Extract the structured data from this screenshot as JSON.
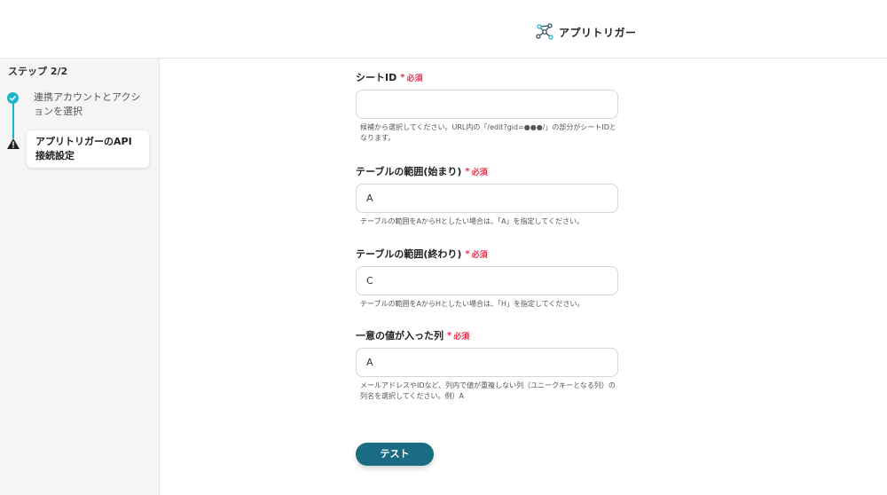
{
  "header": {
    "brand_name": "アプリトリガー",
    "logo_icon": "network-nodes-icon"
  },
  "sidebar": {
    "step_count": "ステップ 2/2",
    "steps": [
      {
        "label": "連携アカウントとアクションを選択",
        "status": "done",
        "icon": "check-circle-icon"
      },
      {
        "label": "アプリトリガーのAPI接続設定",
        "status": "current",
        "icon": "warning-icon"
      }
    ]
  },
  "form": {
    "required_mark": "*",
    "required_text": "必須",
    "fields": [
      {
        "label": "シートID",
        "value": "",
        "help": "候補から選択してください。URL内の「/edit?gid=●●●/」の部分がシートIDとなります。"
      },
      {
        "label": "テーブルの範囲(始まり)",
        "value": "A",
        "help": "テーブルの範囲をAからHとしたい場合は、「A」を指定してください。"
      },
      {
        "label": "テーブルの範囲(終わり)",
        "value": "C",
        "help": "テーブルの範囲をAからHとしたい場合は、「H」を指定してください。"
      },
      {
        "label": "一意の値が入った列",
        "value": "A",
        "help": "メールアドレスやIDなど、列内で値が重複しない列（ユニークキーとなる列）の列名を選択してください。例）A"
      }
    ],
    "test_button": "テスト"
  },
  "colors": {
    "accent": "#1fb3c9",
    "button": "#1a6b84",
    "required": "#e8304a"
  }
}
